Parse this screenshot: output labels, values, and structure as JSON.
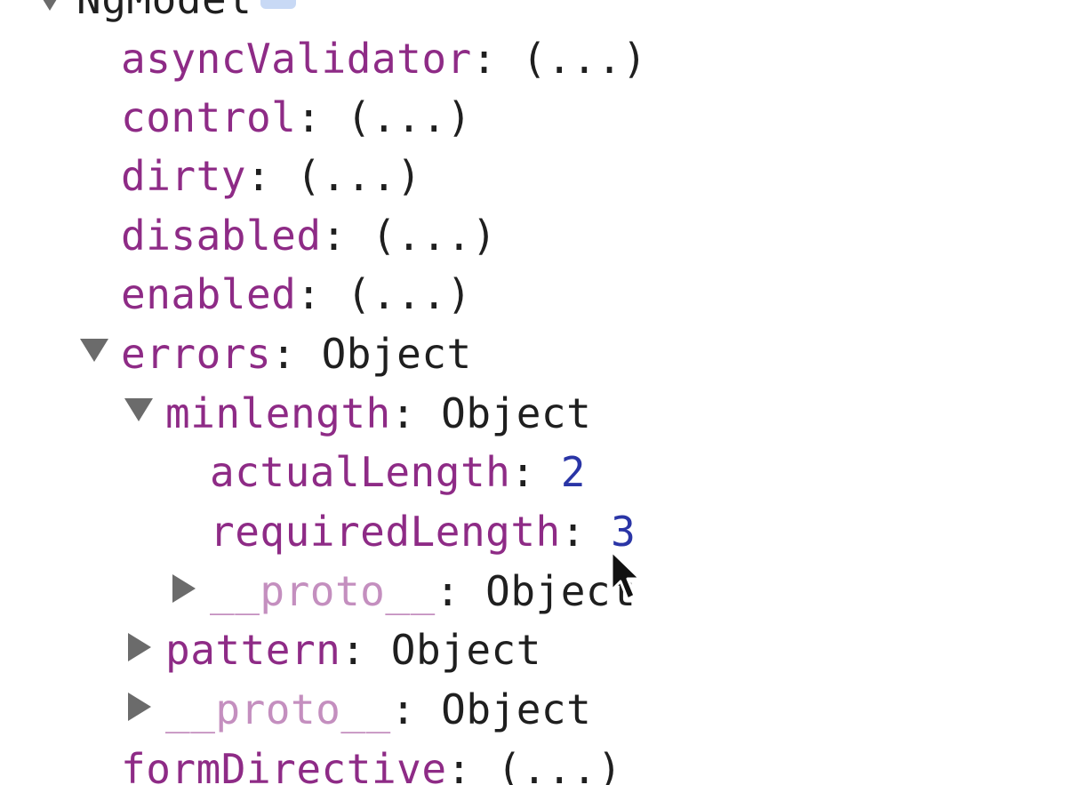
{
  "tree": {
    "root_label": "NgModel",
    "rows": {
      "asyncValidator": {
        "key": "asyncValidator",
        "value": "(...)"
      },
      "control": {
        "key": "control",
        "value": "(...)"
      },
      "dirty": {
        "key": "dirty",
        "value": "(...)"
      },
      "disabled": {
        "key": "disabled",
        "value": "(...)"
      },
      "enabled": {
        "key": "enabled",
        "value": "(...)"
      },
      "errors": {
        "key": "errors",
        "value": "Object",
        "expanded": true
      },
      "minlength": {
        "key": "minlength",
        "value": "Object",
        "expanded": true
      },
      "actualLength": {
        "key": "actualLength",
        "value": "2"
      },
      "requiredLength": {
        "key": "requiredLength",
        "value": "3"
      },
      "minlength_proto": {
        "key": "__proto__",
        "value": "Object",
        "expanded": false
      },
      "pattern": {
        "key": "pattern",
        "value": "Object",
        "expanded": false
      },
      "errors_proto": {
        "key": "__proto__",
        "value": "Object",
        "expanded": false
      },
      "formDirective": {
        "key": "formDirective",
        "value": "(...)"
      }
    },
    "separator": ":"
  },
  "colors": {
    "property_key": "#8e2b86",
    "inherited_key": "#c48fbf",
    "number_value": "#2a35a6",
    "text_value": "#1f1f1f",
    "toggle_triangle": "#6b6b6b"
  }
}
